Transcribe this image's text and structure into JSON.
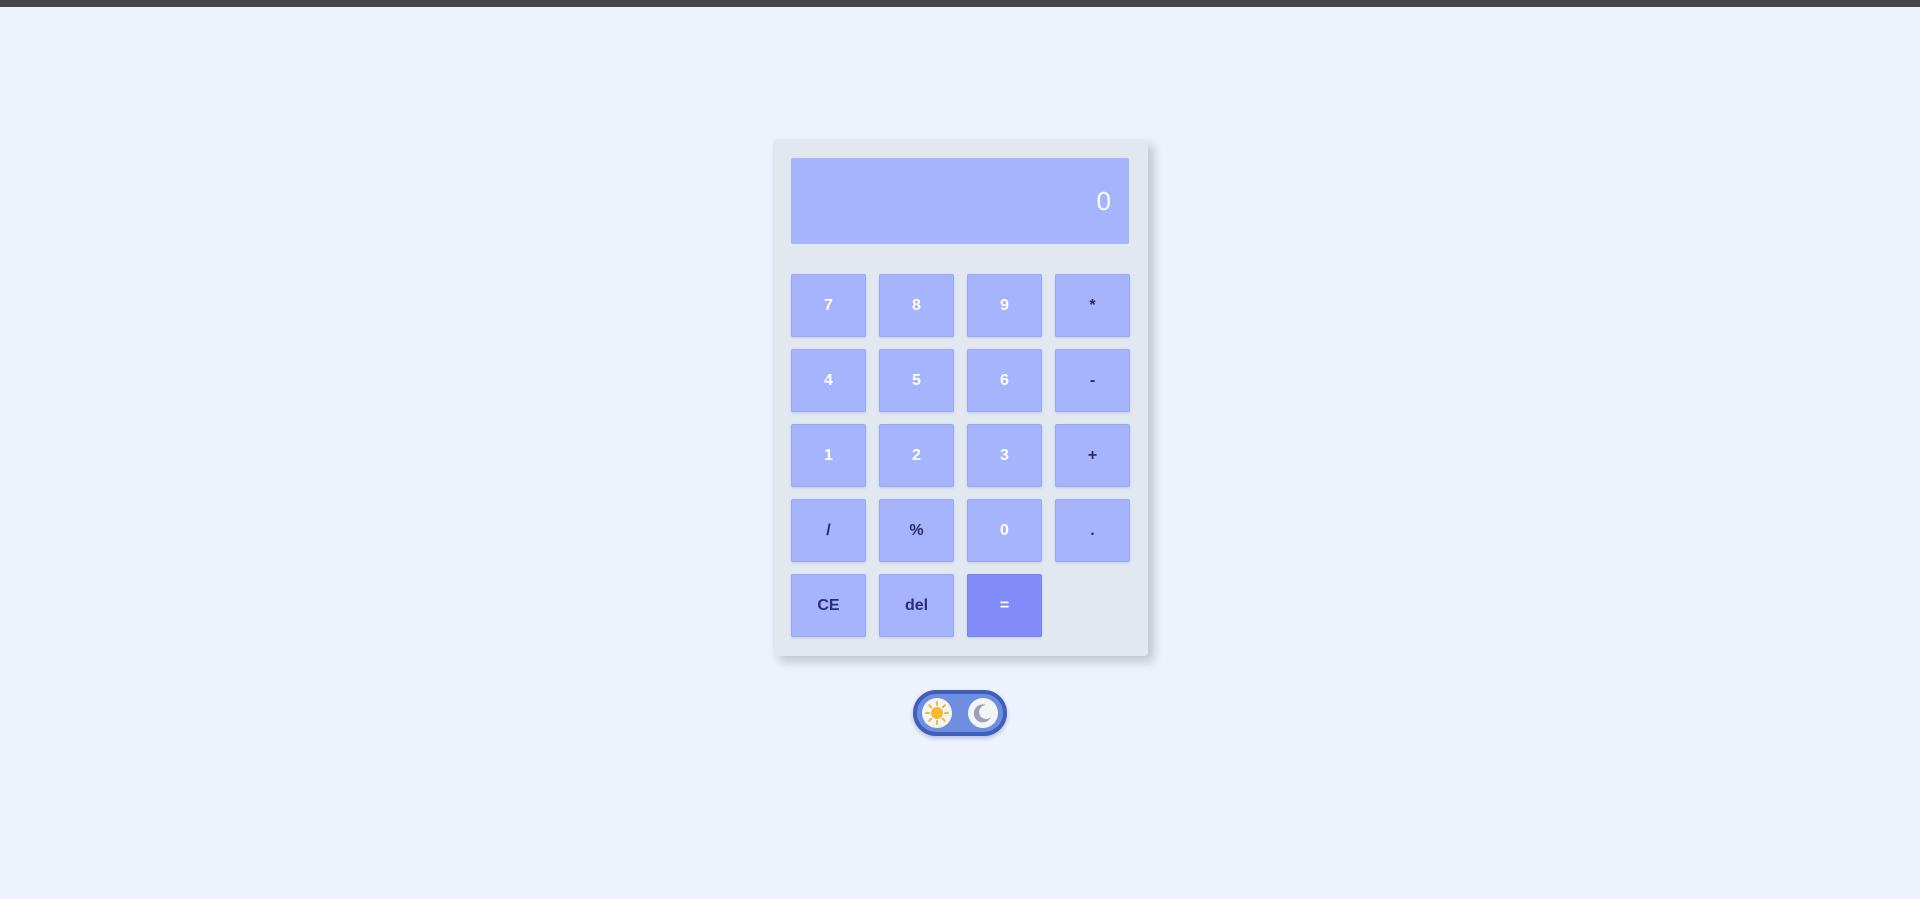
{
  "display": {
    "value": "0"
  },
  "keys": [
    {
      "label": "7",
      "name": "key-7",
      "kind": "num"
    },
    {
      "label": "8",
      "name": "key-8",
      "kind": "num"
    },
    {
      "label": "9",
      "name": "key-9",
      "kind": "num"
    },
    {
      "label": "*",
      "name": "key-multiply",
      "kind": "op"
    },
    {
      "label": "4",
      "name": "key-4",
      "kind": "num"
    },
    {
      "label": "5",
      "name": "key-5",
      "kind": "num"
    },
    {
      "label": "6",
      "name": "key-6",
      "kind": "num"
    },
    {
      "label": "-",
      "name": "key-subtract",
      "kind": "op"
    },
    {
      "label": "1",
      "name": "key-1",
      "kind": "num"
    },
    {
      "label": "2",
      "name": "key-2",
      "kind": "num"
    },
    {
      "label": "3",
      "name": "key-3",
      "kind": "num"
    },
    {
      "label": "+",
      "name": "key-add",
      "kind": "op"
    },
    {
      "label": "/",
      "name": "key-divide",
      "kind": "op"
    },
    {
      "label": "%",
      "name": "key-percent",
      "kind": "op"
    },
    {
      "label": "0",
      "name": "key-0",
      "kind": "num"
    },
    {
      "label": ".",
      "name": "key-decimal",
      "kind": "op"
    },
    {
      "label": "CE",
      "name": "key-clear",
      "kind": "fn"
    },
    {
      "label": "del",
      "name": "key-delete",
      "kind": "fn"
    },
    {
      "label": "=",
      "name": "key-equals",
      "kind": "eq"
    }
  ],
  "theme_toggle": {
    "light_icon": "sun-icon",
    "dark_icon": "moon-icon"
  },
  "colors": {
    "background": "#eef2fd",
    "panel": "#e2e8f0",
    "key": "#a5b4fc",
    "equals_key": "#818cf8",
    "toggle_track": "#6f8ee0",
    "toggle_border": "#3f5fb8",
    "sun": "#f5b82e",
    "moon": "#9aa0b5"
  }
}
